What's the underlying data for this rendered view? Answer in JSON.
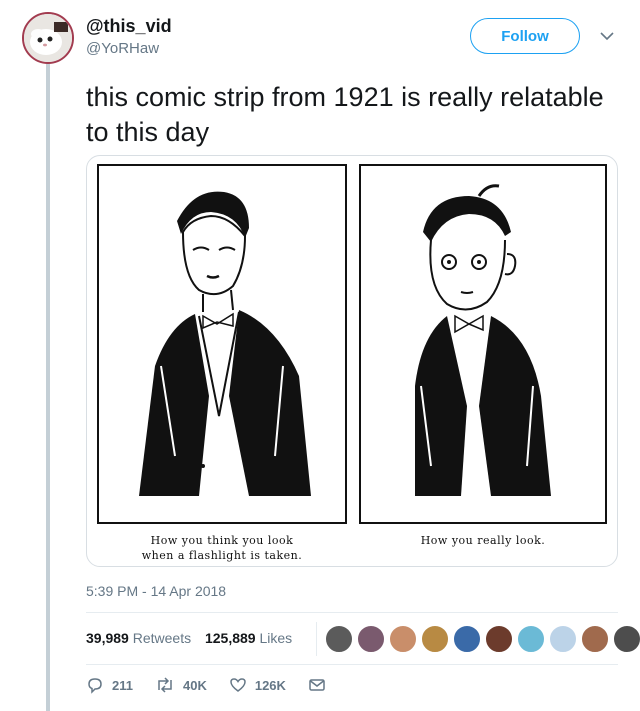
{
  "user": {
    "display_name": "@this_vid",
    "handle": "@YoRHaw"
  },
  "follow_label": "Follow",
  "tweet": {
    "text": "this comic strip from 1921 is really relatable to this day",
    "timestamp": "5:39 PM - 14 Apr 2018"
  },
  "comic": {
    "caption_left_line1": "How you think you look",
    "caption_left_line2": "when a flashlight is taken.",
    "caption_right": "How you really look."
  },
  "stats": {
    "retweets_count": "39,989",
    "retweets_label": "Retweets",
    "likes_count": "125,889",
    "likes_label": "Likes"
  },
  "actions": {
    "reply_count": "211",
    "retweet_count": "40K",
    "like_count": "126K"
  },
  "colors": {
    "accent": "#1da1f2",
    "muted": "#657786",
    "text": "#14171a"
  },
  "liker_avatar_colors": [
    "#5b5b5b",
    "#7a5a6e",
    "#c98e6a",
    "#b88a43",
    "#3a6aa8",
    "#6c3b2c",
    "#6bbad6",
    "#bcd3e8",
    "#a06a4d",
    "#4d4d4d"
  ]
}
